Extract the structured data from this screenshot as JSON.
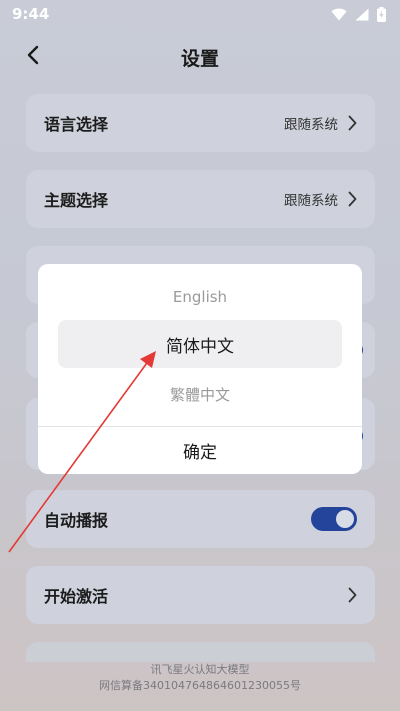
{
  "status_bar": {
    "time": "9:44",
    "icons": [
      "wifi-icon",
      "cellular-signal-icon",
      "battery-charging-icon"
    ]
  },
  "header": {
    "title": "设置",
    "back_icon": "chevron-left-icon"
  },
  "settings": {
    "language": {
      "label": "语言选择",
      "value": "跟随系统"
    },
    "theme": {
      "label": "主题选择",
      "value": "跟随系统"
    },
    "auto_broadcast": {
      "label": "自动播报",
      "enabled": true
    },
    "activate": {
      "label": "开始激活"
    }
  },
  "dialog": {
    "options": [
      "English",
      "简体中文",
      "繁體中文"
    ],
    "selected": "简体中文",
    "confirm_label": "确定"
  },
  "footer": {
    "line1": "讯飞星火认知大模型",
    "line2": "网信算备340104764864601230055号"
  },
  "colors": {
    "accent": "#24439a",
    "annotation_arrow": "#e53935"
  }
}
